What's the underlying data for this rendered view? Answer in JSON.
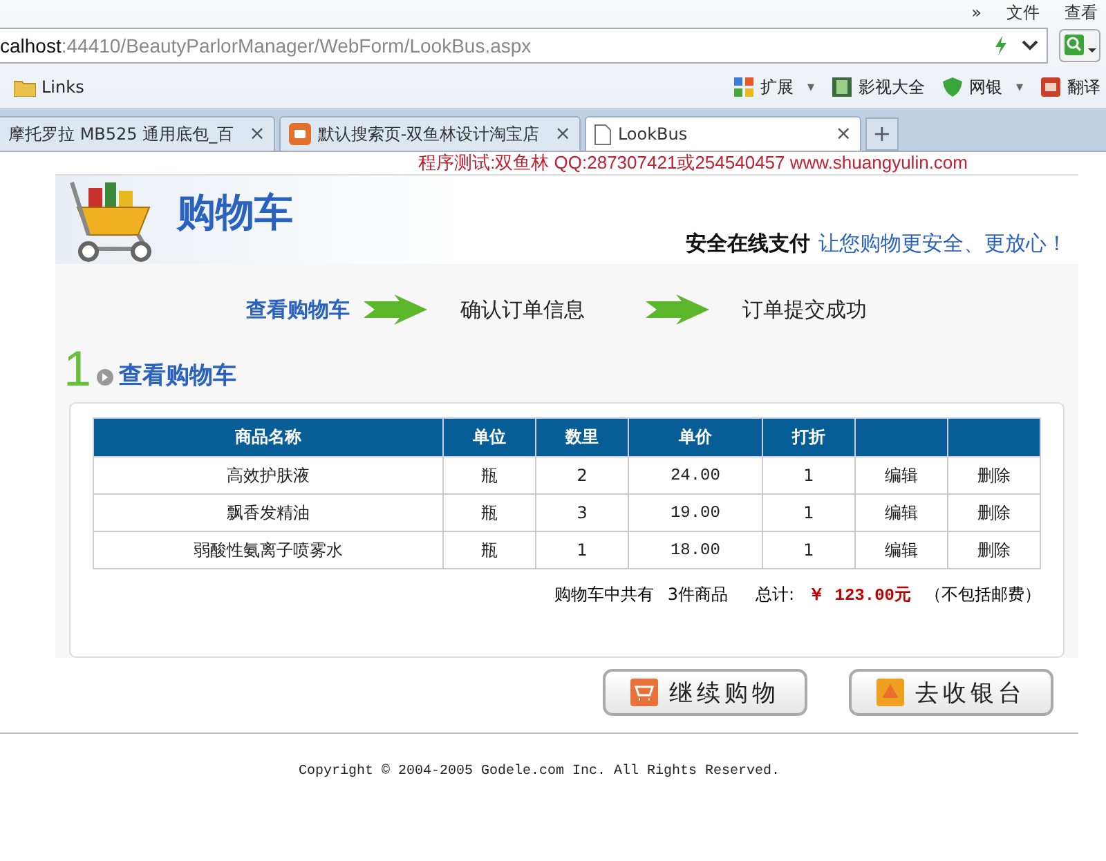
{
  "browser": {
    "menu": [
      "»",
      "文件",
      "查看"
    ],
    "address": {
      "host": "calhost",
      "path": ":44410/BeautyParlorManager/WebForm/LookBus.aspx"
    },
    "bookmarks": [
      {
        "label": "Links",
        "kind": "folder"
      }
    ],
    "toolbar": [
      {
        "label": "扩展",
        "kind": "apps",
        "dropdown": "▾"
      },
      {
        "label": "影视大全",
        "kind": "film"
      },
      {
        "label": "网银",
        "kind": "shield",
        "dropdown": "▾"
      },
      {
        "label": "翻译",
        "kind": "dict"
      }
    ],
    "tabs": [
      {
        "label": "摩托罗拉 MB525 通用底包_百",
        "selected": false,
        "kind": "plain",
        "close": "×"
      },
      {
        "label": "默认搜索页-双鱼林设计淘宝店",
        "selected": false,
        "kind": "taobao",
        "close": "×"
      },
      {
        "label": "LookBus",
        "selected": true,
        "kind": "page",
        "close": "×"
      }
    ],
    "new_tab": "+"
  },
  "page": {
    "notice": "程序测试:双鱼林 QQ:287307421或254540457 www.shuangyulin.com",
    "logo_text": "购物车",
    "slogan": {
      "lead": "安全在线支付",
      "rest": "让您购物更安全、更放心！"
    },
    "steps": [
      {
        "label": "查看购物车",
        "selected": true
      },
      {
        "label": "确认订单信息",
        "selected": false
      },
      {
        "label": "订单提交成功",
        "selected": false
      }
    ],
    "section": {
      "number": "1",
      "title": "查看购物车"
    },
    "table": {
      "columns": [
        "商品名称",
        "单位",
        "数里",
        "单价",
        "打折"
      ],
      "rows": [
        {
          "name": "高效护肤液",
          "unit": "瓶",
          "qty": "2",
          "price": "24.00",
          "discount": "1",
          "edit": "编辑",
          "delete": "删除"
        },
        {
          "name": "飘香发精油",
          "unit": "瓶",
          "qty": "3",
          "price": "19.00",
          "discount": "1",
          "edit": "编辑",
          "delete": "删除"
        },
        {
          "name": "弱酸性氨离子喷雾水",
          "unit": "瓶",
          "qty": "1",
          "price": "18.00",
          "discount": "1",
          "edit": "编辑",
          "delete": "删除"
        }
      ]
    },
    "summary": {
      "count_label": "购物车中共有",
      "count": "3件商品",
      "total_label": "总计:",
      "total": "￥ 123.00元",
      "note": "（不包括邮费）"
    },
    "buttons": [
      {
        "label": "继续购物",
        "kind": "cart"
      },
      {
        "label": "去收银台",
        "kind": "cashier"
      }
    ],
    "copyright": "Copyright © 2004-2005 Godele.com Inc. All Rights Reserved."
  }
}
